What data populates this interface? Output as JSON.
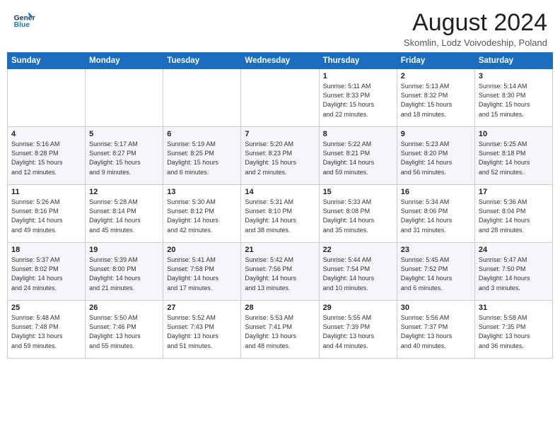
{
  "header": {
    "logo_line1": "General",
    "logo_line2": "Blue",
    "month": "August 2024",
    "location": "Skomlin, Lodz Voivodeship, Poland"
  },
  "weekdays": [
    "Sunday",
    "Monday",
    "Tuesday",
    "Wednesday",
    "Thursday",
    "Friday",
    "Saturday"
  ],
  "weeks": [
    [
      {
        "day": "",
        "info": ""
      },
      {
        "day": "",
        "info": ""
      },
      {
        "day": "",
        "info": ""
      },
      {
        "day": "",
        "info": ""
      },
      {
        "day": "1",
        "info": "Sunrise: 5:11 AM\nSunset: 8:33 PM\nDaylight: 15 hours\nand 22 minutes."
      },
      {
        "day": "2",
        "info": "Sunrise: 5:13 AM\nSunset: 8:32 PM\nDaylight: 15 hours\nand 18 minutes."
      },
      {
        "day": "3",
        "info": "Sunrise: 5:14 AM\nSunset: 8:30 PM\nDaylight: 15 hours\nand 15 minutes."
      }
    ],
    [
      {
        "day": "4",
        "info": "Sunrise: 5:16 AM\nSunset: 8:28 PM\nDaylight: 15 hours\nand 12 minutes."
      },
      {
        "day": "5",
        "info": "Sunrise: 5:17 AM\nSunset: 8:27 PM\nDaylight: 15 hours\nand 9 minutes."
      },
      {
        "day": "6",
        "info": "Sunrise: 5:19 AM\nSunset: 8:25 PM\nDaylight: 15 hours\nand 6 minutes."
      },
      {
        "day": "7",
        "info": "Sunrise: 5:20 AM\nSunset: 8:23 PM\nDaylight: 15 hours\nand 2 minutes."
      },
      {
        "day": "8",
        "info": "Sunrise: 5:22 AM\nSunset: 8:21 PM\nDaylight: 14 hours\nand 59 minutes."
      },
      {
        "day": "9",
        "info": "Sunrise: 5:23 AM\nSunset: 8:20 PM\nDaylight: 14 hours\nand 56 minutes."
      },
      {
        "day": "10",
        "info": "Sunrise: 5:25 AM\nSunset: 8:18 PM\nDaylight: 14 hours\nand 52 minutes."
      }
    ],
    [
      {
        "day": "11",
        "info": "Sunrise: 5:26 AM\nSunset: 8:16 PM\nDaylight: 14 hours\nand 49 minutes."
      },
      {
        "day": "12",
        "info": "Sunrise: 5:28 AM\nSunset: 8:14 PM\nDaylight: 14 hours\nand 45 minutes."
      },
      {
        "day": "13",
        "info": "Sunrise: 5:30 AM\nSunset: 8:12 PM\nDaylight: 14 hours\nand 42 minutes."
      },
      {
        "day": "14",
        "info": "Sunrise: 5:31 AM\nSunset: 8:10 PM\nDaylight: 14 hours\nand 38 minutes."
      },
      {
        "day": "15",
        "info": "Sunrise: 5:33 AM\nSunset: 8:08 PM\nDaylight: 14 hours\nand 35 minutes."
      },
      {
        "day": "16",
        "info": "Sunrise: 5:34 AM\nSunset: 8:06 PM\nDaylight: 14 hours\nand 31 minutes."
      },
      {
        "day": "17",
        "info": "Sunrise: 5:36 AM\nSunset: 8:04 PM\nDaylight: 14 hours\nand 28 minutes."
      }
    ],
    [
      {
        "day": "18",
        "info": "Sunrise: 5:37 AM\nSunset: 8:02 PM\nDaylight: 14 hours\nand 24 minutes."
      },
      {
        "day": "19",
        "info": "Sunrise: 5:39 AM\nSunset: 8:00 PM\nDaylight: 14 hours\nand 21 minutes."
      },
      {
        "day": "20",
        "info": "Sunrise: 5:41 AM\nSunset: 7:58 PM\nDaylight: 14 hours\nand 17 minutes."
      },
      {
        "day": "21",
        "info": "Sunrise: 5:42 AM\nSunset: 7:56 PM\nDaylight: 14 hours\nand 13 minutes."
      },
      {
        "day": "22",
        "info": "Sunrise: 5:44 AM\nSunset: 7:54 PM\nDaylight: 14 hours\nand 10 minutes."
      },
      {
        "day": "23",
        "info": "Sunrise: 5:45 AM\nSunset: 7:52 PM\nDaylight: 14 hours\nand 6 minutes."
      },
      {
        "day": "24",
        "info": "Sunrise: 5:47 AM\nSunset: 7:50 PM\nDaylight: 14 hours\nand 3 minutes."
      }
    ],
    [
      {
        "day": "25",
        "info": "Sunrise: 5:48 AM\nSunset: 7:48 PM\nDaylight: 13 hours\nand 59 minutes."
      },
      {
        "day": "26",
        "info": "Sunrise: 5:50 AM\nSunset: 7:46 PM\nDaylight: 13 hours\nand 55 minutes."
      },
      {
        "day": "27",
        "info": "Sunrise: 5:52 AM\nSunset: 7:43 PM\nDaylight: 13 hours\nand 51 minutes."
      },
      {
        "day": "28",
        "info": "Sunrise: 5:53 AM\nSunset: 7:41 PM\nDaylight: 13 hours\nand 48 minutes."
      },
      {
        "day": "29",
        "info": "Sunrise: 5:55 AM\nSunset: 7:39 PM\nDaylight: 13 hours\nand 44 minutes."
      },
      {
        "day": "30",
        "info": "Sunrise: 5:56 AM\nSunset: 7:37 PM\nDaylight: 13 hours\nand 40 minutes."
      },
      {
        "day": "31",
        "info": "Sunrise: 5:58 AM\nSunset: 7:35 PM\nDaylight: 13 hours\nand 36 minutes."
      }
    ]
  ]
}
